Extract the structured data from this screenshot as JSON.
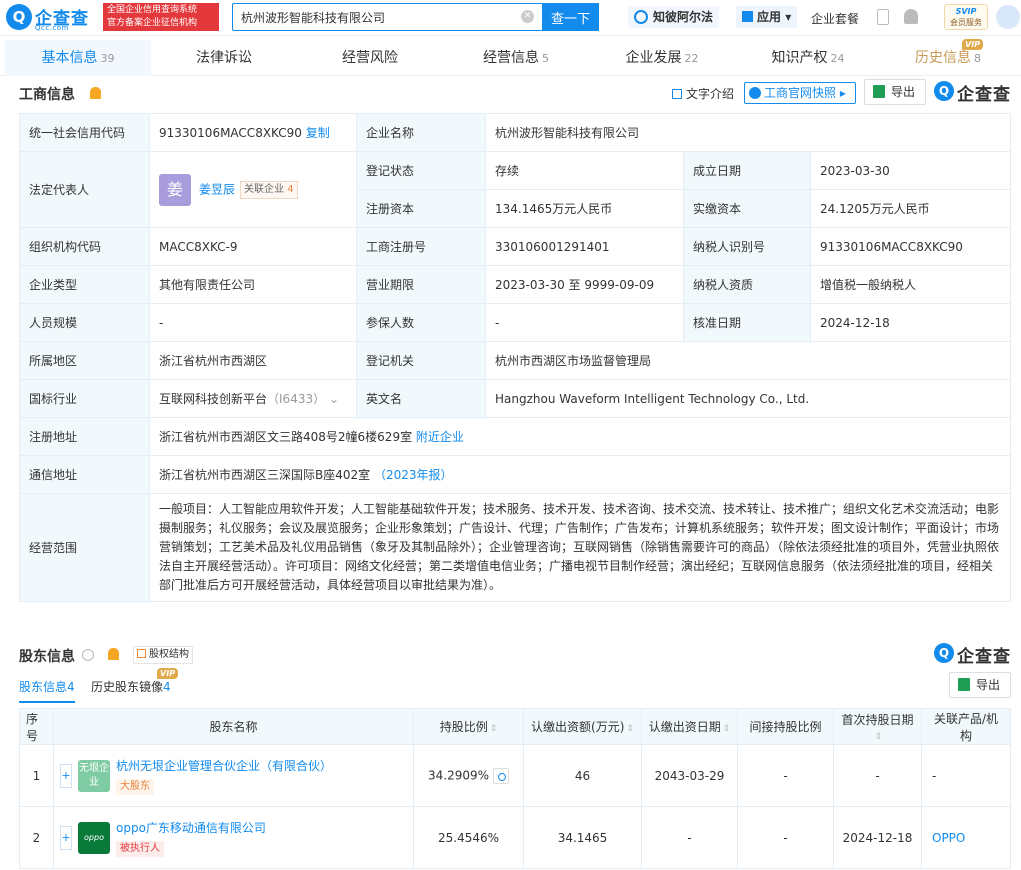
{
  "header": {
    "logo_mark": "Q",
    "logo_name": "企查查",
    "logo_sub": "Qcc.com",
    "badge_line1": "全国企业信用查询系统",
    "badge_line2": "官方备案企业征信机构",
    "search_value": "杭州波形智能科技有限公司",
    "search_button": "查一下",
    "ai_label": "知彼阿尔法",
    "app_label": "应用",
    "suite_label": "企业套餐",
    "svip_line1": "SVIP",
    "svip_line2": "会员服务"
  },
  "tabs": [
    {
      "label": "基本信息",
      "count": "39"
    },
    {
      "label": "法律诉讼",
      "count": ""
    },
    {
      "label": "经营风险",
      "count": ""
    },
    {
      "label": "经营信息",
      "count": "5"
    },
    {
      "label": "企业发展",
      "count": "22"
    },
    {
      "label": "知识产权",
      "count": "24"
    },
    {
      "label": "历史信息",
      "count": "8",
      "vip": "VIP"
    }
  ],
  "business": {
    "title": "工商信息",
    "text_intro": "文字介绍",
    "snapshot": "工商官网快照",
    "export": "导出",
    "brand": "企查查",
    "credit_code_label": "统一社会信用代码",
    "credit_code": "91330106MACC8XKC90",
    "copy": "复制",
    "company_name_label": "企业名称",
    "company_name": "杭州波形智能科技有限公司",
    "legal_rep_label": "法定代表人",
    "legal_rep_avatar": "姜",
    "legal_rep": "姜昱辰",
    "related_label": "关联企业",
    "related_count": "4",
    "reg_status_label": "登记状态",
    "reg_status": "存续",
    "est_date_label": "成立日期",
    "est_date": "2023-03-30",
    "reg_capital_label": "注册资本",
    "reg_capital": "134.1465万元人民币",
    "paid_capital_label": "实缴资本",
    "paid_capital": "24.1205万元人民币",
    "org_code_label": "组织机构代码",
    "org_code": "MACC8XKC-9",
    "reg_no_label": "工商注册号",
    "reg_no": "330106001291401",
    "taxpayer_id_label": "纳税人识别号",
    "taxpayer_id": "91330106MACC8XKC90",
    "type_label": "企业类型",
    "type": "其他有限责任公司",
    "term_label": "营业期限",
    "term": "2023-03-30 至 9999-09-09",
    "tax_qual_label": "纳税人资质",
    "tax_qual": "增值税一般纳税人",
    "staff_label": "人员规模",
    "staff": "-",
    "insured_label": "参保人数",
    "insured": "-",
    "approve_label": "核准日期",
    "approve": "2024-12-18",
    "region_label": "所属地区",
    "region": "浙江省杭州市西湖区",
    "authority_label": "登记机关",
    "authority": "杭州市西湖区市场监督管理局",
    "industry_label": "国标行业",
    "industry": "互联网科技创新平台",
    "industry_code": "（I6433）",
    "en_name_label": "英文名",
    "en_name": "Hangzhou Waveform Intelligent Technology Co., Ltd.",
    "reg_addr_label": "注册地址",
    "reg_addr": "浙江省杭州市西湖区文三路408号2幢6楼629室",
    "nearby": "附近企业",
    "mail_addr_label": "通信地址",
    "mail_addr": "浙江省杭州市西湖区三深国际B座402室",
    "annual_report": "（2023年报）",
    "scope_label": "经营范围",
    "scope": "一般项目：人工智能应用软件开发；人工智能基础软件开发；技术服务、技术开发、技术咨询、技术交流、技术转让、技术推广；组织文化艺术交流活动；电影摄制服务；礼仪服务；会议及展览服务；企业形象策划；广告设计、代理；广告制作；广告发布；计算机系统服务；软件开发；图文设计制作；平面设计；市场营销策划；工艺美术品及礼仪用品销售（象牙及其制品除外）；企业管理咨询；互联网销售（除销售需要许可的商品）（除依法须经批准的项目外，凭营业执照依法自主开展经营活动）。许可项目：网络文化经营；第二类增值电信业务；广播电视节目制作经营；演出经纪；互联网信息服务（依法须经批准的项目，经相关部门批准后方可开展经营活动，具体经营项目以审批结果为准）。"
  },
  "shareholders": {
    "title": "股东信息",
    "equity_structure": "股权结构",
    "brand": "企查查",
    "export": "导出",
    "subtab_current": "股东信息",
    "subtab_current_count": "4",
    "subtab_history": "历史股东镜像",
    "subtab_history_count": "4",
    "subtab_history_vip": "VIP",
    "columns": [
      "序号",
      "股东名称",
      "持股比例",
      "认缴出资额(万元)",
      "认缴出资日期",
      "间接持股比例",
      "首次持股日期",
      "关联产品/机构"
    ],
    "rows": [
      {
        "index": "1",
        "logo": "无垠企业",
        "name": "杭州无垠企业管理合伙企业（有限合伙）",
        "tag": "大股东",
        "ratio": "34.2909%",
        "amount": "46",
        "date": "2043-03-29",
        "indirect": "-",
        "first": "-",
        "product": "-"
      },
      {
        "index": "2",
        "logo": "oppo",
        "name": "oppo广东移动通信有限公司",
        "tag": "被执行人",
        "ratio": "25.4546%",
        "amount": "34.1465",
        "date": "-",
        "indirect": "-",
        "first": "2024-12-18",
        "product": "OPPO"
      }
    ]
  },
  "colors": {
    "brand": "#128bed",
    "label_bg": "#f2f9fc",
    "badge_red": "#e4393c"
  }
}
